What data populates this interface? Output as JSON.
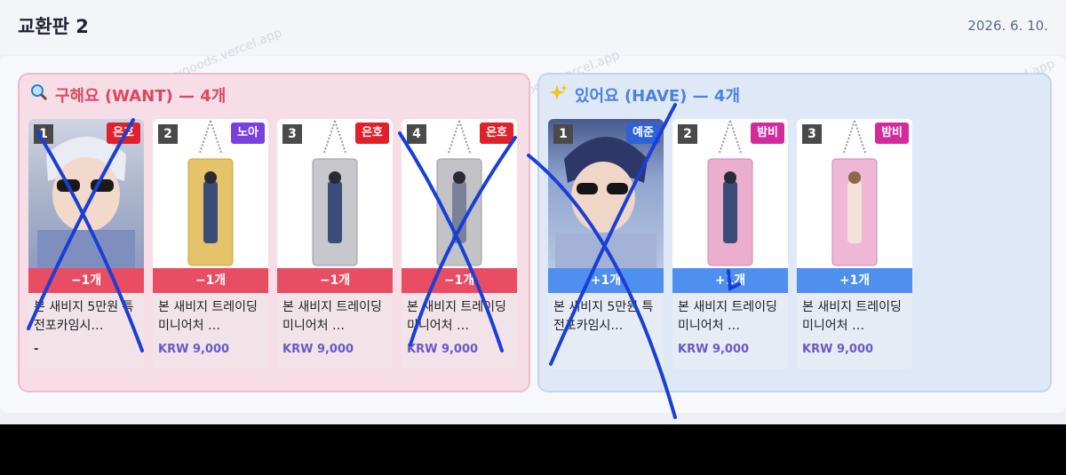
{
  "header": {
    "title": "교환판 2",
    "date": "2026. 6. 10."
  },
  "want": {
    "title": "구해요 (WANT) — 4개",
    "items": [
      {
        "num": "1",
        "tag": "은호",
        "tag_color": "#e0202a",
        "qty": "−1개",
        "name": "본 새비지 5만원 특전포카임시…",
        "price": "-"
      },
      {
        "num": "2",
        "tag": "노아",
        "tag_color": "#7b3fe0",
        "qty": "−1개",
        "name": "본 새비지 트레이딩미니어처 …",
        "price": "KRW 9,000"
      },
      {
        "num": "3",
        "tag": "은호",
        "tag_color": "#e0202a",
        "qty": "−1개",
        "name": "본 새비지 트레이딩미니어처 …",
        "price": "KRW 9,000"
      },
      {
        "num": "4",
        "tag": "은호",
        "tag_color": "#e0202a",
        "qty": "−1개",
        "name": "본 새비지 트레이딩미니어처 …",
        "price": "KRW 9,000"
      }
    ]
  },
  "have": {
    "title": "있어요 (HAVE) — 4개",
    "items": [
      {
        "num": "1",
        "tag": "예준",
        "tag_color": "#2d63d8",
        "qty": "+1개",
        "name": "본 새비지 5만원 특전포카임시…",
        "price": ""
      },
      {
        "num": "2",
        "tag": "밤비",
        "tag_color": "#d42a9a",
        "qty": "+1개",
        "name": "본 새비지 트레이딩미니어처 …",
        "price": "KRW 9,000"
      },
      {
        "num": "3",
        "tag": "밤비",
        "tag_color": "#d42a9a",
        "qty": "+1개",
        "name": "본 새비지 트레이딩미니어처 …",
        "price": "KRW 9,000"
      }
    ]
  },
  "watermark": "mygoods.vercel.app",
  "colors": {
    "want_accent": "#e0465f",
    "have_accent": "#4a82de",
    "annotation": "#1a3fd6"
  }
}
